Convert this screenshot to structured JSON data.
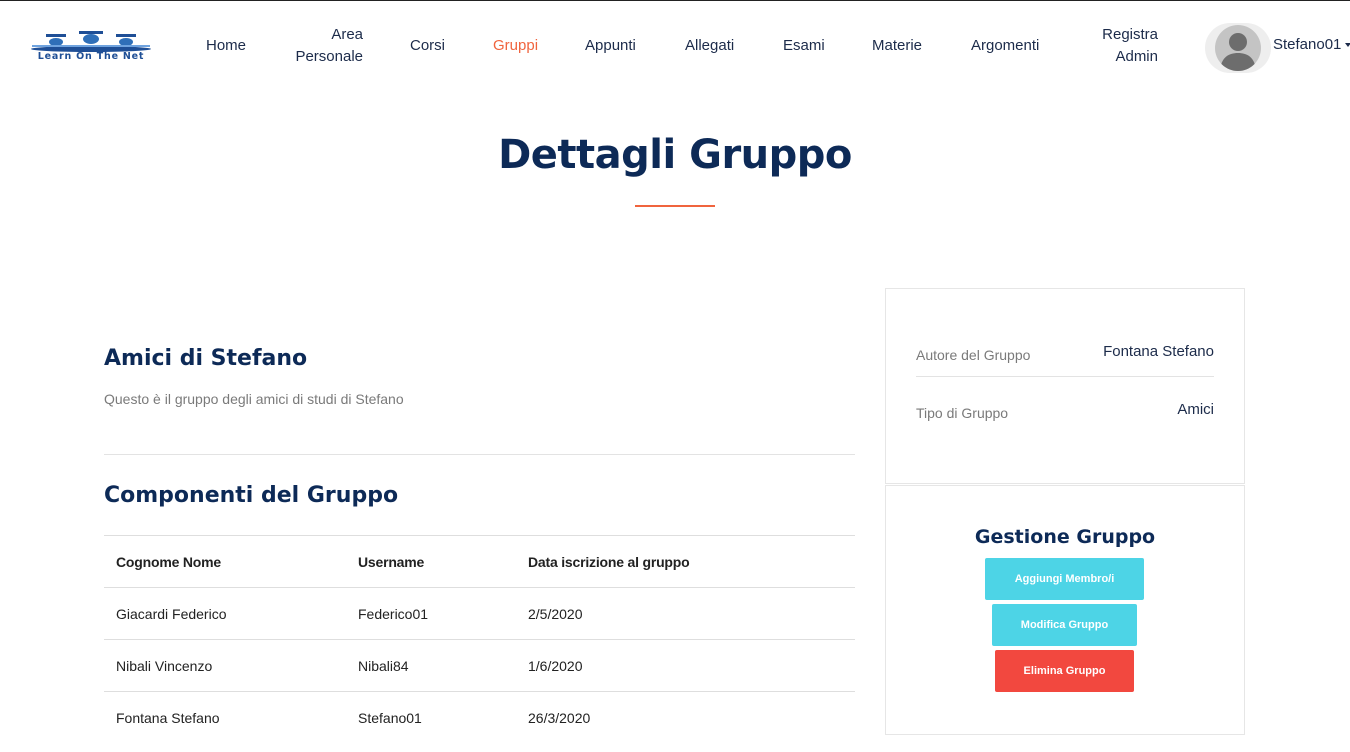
{
  "header": {
    "logo_text": "Learn On The Net",
    "nav": [
      {
        "label": "Home"
      },
      {
        "label": "Area Personale"
      },
      {
        "label": "Corsi"
      },
      {
        "label": "Gruppi",
        "active": true
      },
      {
        "label": "Appunti"
      },
      {
        "label": "Allegati"
      },
      {
        "label": "Esami"
      },
      {
        "label": "Materie"
      },
      {
        "label": "Argomenti"
      },
      {
        "label": "Registra Admin"
      }
    ],
    "user": {
      "name": "Stefano01",
      "avatar_icon": "user-placeholder-icon"
    }
  },
  "page": {
    "title": "Dettagli Gruppo"
  },
  "group": {
    "name": "Amici di Stefano",
    "description": "Questo è il gruppo degli amici di studi di Stefano"
  },
  "members": {
    "title": "Componenti del Gruppo",
    "columns": [
      "Cognome Nome",
      "Username",
      "Data iscrizione al gruppo"
    ],
    "rows": [
      [
        "Giacardi Federico",
        "Federico01",
        "2/5/2020"
      ],
      [
        "Nibali Vincenzo",
        "Nibali84",
        "1/6/2020"
      ],
      [
        "Fontana Stefano",
        "Stefano01",
        "26/3/2020"
      ]
    ]
  },
  "info": {
    "author_label": "Autore del Gruppo",
    "author_value": "Fontana Stefano",
    "type_label": "Tipo di Gruppo",
    "type_value": "Amici"
  },
  "manage": {
    "title": "Gestione Gruppo",
    "add_label": "Aggiungi Membro/i",
    "edit_label": "Modifica Gruppo",
    "delete_label": "Elimina Gruppo"
  },
  "colors": {
    "accent": "#f0643e",
    "navy": "#0d2a57",
    "cyan_button": "#4dd4e6",
    "red_button": "#f2483f"
  }
}
